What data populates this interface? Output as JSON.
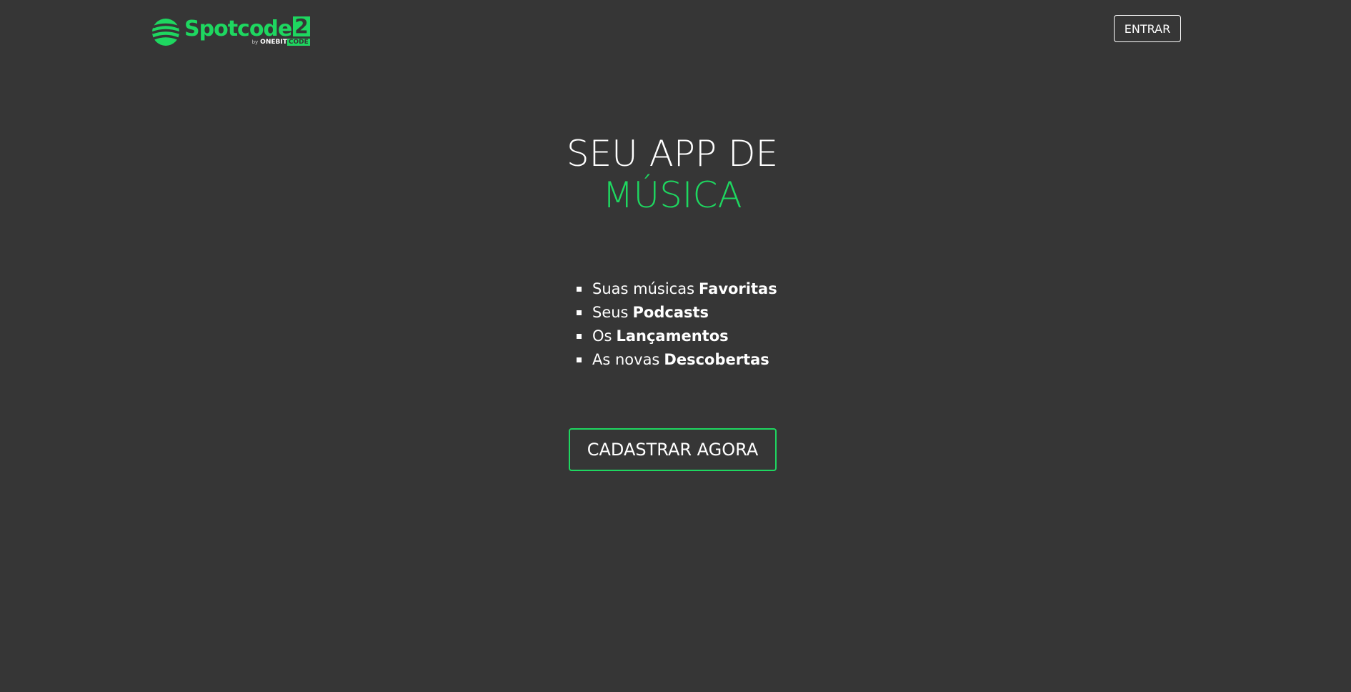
{
  "header": {
    "logo": {
      "word": "Spotcode",
      "number": "2",
      "by": "by",
      "brand_one": "ONEBIT",
      "brand_code": "CODE"
    },
    "enter_label": "ENTRAR"
  },
  "hero": {
    "title_line1": "SEU APP DE",
    "title_line2": "MÚSICA"
  },
  "features": [
    {
      "prefix": "Suas músicas",
      "highlight": "Favoritas"
    },
    {
      "prefix": "Seus",
      "highlight": "Podcasts"
    },
    {
      "prefix": "Os",
      "highlight": "Lançamentos"
    },
    {
      "prefix": "As novas",
      "highlight": "Descobertas"
    }
  ],
  "cta": {
    "signup_label": "CADASTRAR AGORA"
  },
  "colors": {
    "background": "#363636",
    "accent": "#1ed760",
    "text": "#ffffff"
  }
}
